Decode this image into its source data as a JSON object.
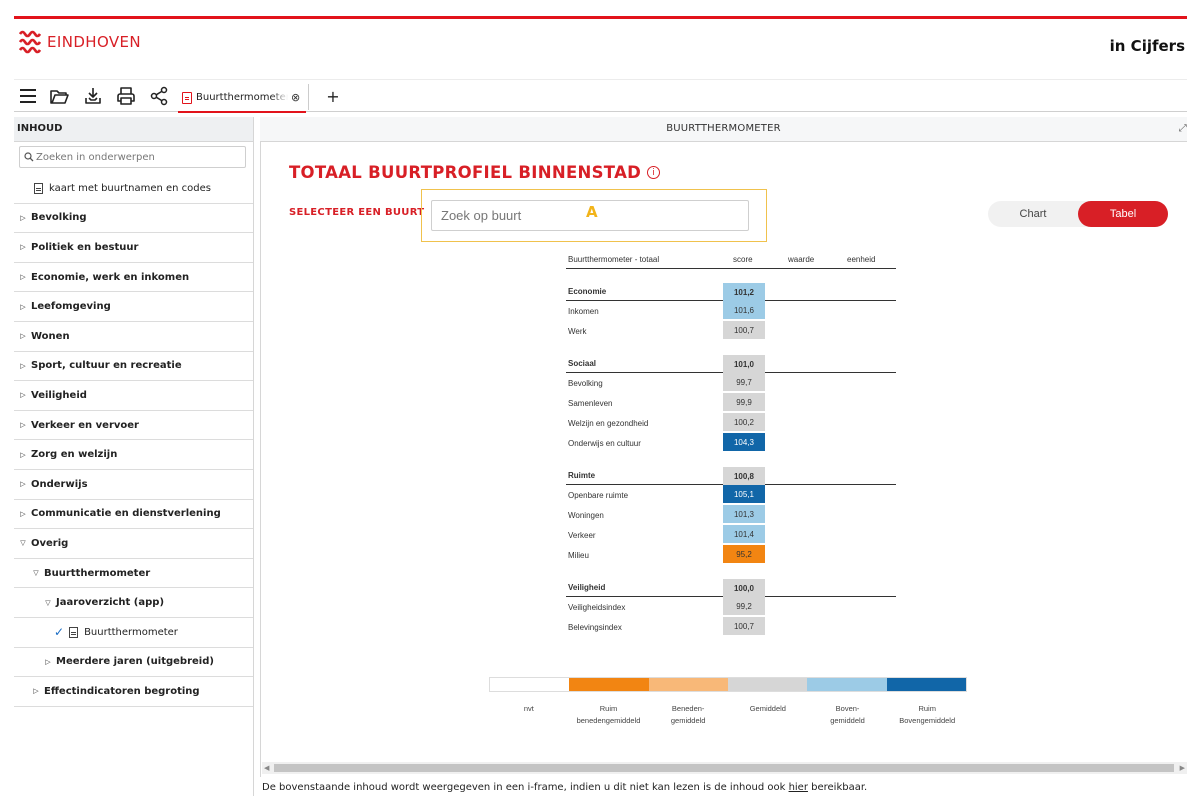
{
  "header": {
    "logo_text": "EINDHOVEN",
    "app_title": "in Cijfers",
    "brand_color": "#d81f26"
  },
  "toolbar": {
    "icons": [
      "menu-icon",
      "folder-open-icon",
      "download-icon",
      "print-icon",
      "share-icon"
    ],
    "tab_label": "Buurtthermometer",
    "tab_close": "⊗",
    "add_tab": "+"
  },
  "sidebar": {
    "heading": "INHOUD",
    "search_placeholder": "Zoeken in onderwerpen",
    "map_item": "kaart met buurtnamen en codes",
    "items": [
      "Bevolking",
      "Politiek en bestuur",
      "Economie, werk en inkomen",
      "Leefomgeving",
      "Wonen",
      "Sport, cultuur en recreatie",
      "Veiligheid",
      "Verkeer en vervoer",
      "Zorg en welzijn",
      "Onderwijs",
      "Communicatie en dienstverlening",
      "Overig"
    ],
    "sub1": "Buurtthermometer",
    "sub2": "Jaaroverzicht (app)",
    "sub3": "Buurtthermometer",
    "sub4": "Meerdere jaren (uitgebreid)",
    "sub5": "Effectindicatoren begroting"
  },
  "content": {
    "heading": "BUURTTHERMOMETER",
    "title": "TOTAAL BUURTPROFIEL BINNENSTAD",
    "info_glyph": "i",
    "select_label": "SELECTEER EEN BUURT",
    "search_placeholder": "Zoek op buurt",
    "annotation": "A",
    "toggle": {
      "chart": "Chart",
      "tabel": "Tabel",
      "active": "Tabel"
    }
  },
  "table": {
    "headers": {
      "name": "Buurtthermometer - totaal",
      "score": "score",
      "waarde": "waarde",
      "eenheid": "eenheid"
    },
    "groups": [
      {
        "name": "Economie",
        "score": "101,2",
        "color": "#9ccbe6",
        "rows": [
          {
            "name": "Inkomen",
            "score": "101,6",
            "color": "#9ccbe6"
          },
          {
            "name": "Werk",
            "score": "100,7",
            "color": "#d6d6d6"
          }
        ]
      },
      {
        "name": "Sociaal",
        "score": "101,0",
        "color": "#d6d6d6",
        "rows": [
          {
            "name": "Bevolking",
            "score": "99,7",
            "color": "#d6d6d6"
          },
          {
            "name": "Samenleven",
            "score": "99,9",
            "color": "#d6d6d6"
          },
          {
            "name": "Welzijn en gezondheid",
            "score": "100,2",
            "color": "#d6d6d6"
          },
          {
            "name": "Onderwijs en cultuur",
            "score": "104,3",
            "color": "#1166a8"
          }
        ]
      },
      {
        "name": "Ruimte",
        "score": "100,8",
        "color": "#d6d6d6",
        "rows": [
          {
            "name": "Openbare ruimte",
            "score": "105,1",
            "color": "#1166a8"
          },
          {
            "name": "Woningen",
            "score": "101,3",
            "color": "#9ccbe6"
          },
          {
            "name": "Verkeer",
            "score": "101,4",
            "color": "#9ccbe6"
          },
          {
            "name": "Milieu",
            "score": "95,2",
            "color": "#f28512"
          }
        ]
      },
      {
        "name": "Veiligheid",
        "score": "100,0",
        "color": "#d6d6d6",
        "rows": [
          {
            "name": "Veiligheidsindex",
            "score": "99,2",
            "color": "#d6d6d6"
          },
          {
            "name": "Belevingsindex",
            "score": "100,7",
            "color": "#d6d6d6"
          }
        ]
      }
    ]
  },
  "legend": [
    {
      "label": "nvt",
      "color": "#ffffff"
    },
    {
      "label": "Ruim\nbenedengemiddeld",
      "color": "#f28512"
    },
    {
      "label": "Beneden-\ngemiddeld",
      "color": "#f8b878"
    },
    {
      "label": "Gemiddeld",
      "color": "#d6d6d6"
    },
    {
      "label": "Boven-\ngemiddeld",
      "color": "#9ccbe6"
    },
    {
      "label": "Ruim\nBovengemiddeld",
      "color": "#1166a8"
    }
  ],
  "footer": {
    "before": "De bovenstaande inhoud wordt weergegeven in een i-frame, indien u dit niet kan lezen is de inhoud ook ",
    "link": "hier",
    "after": " bereikbaar."
  }
}
